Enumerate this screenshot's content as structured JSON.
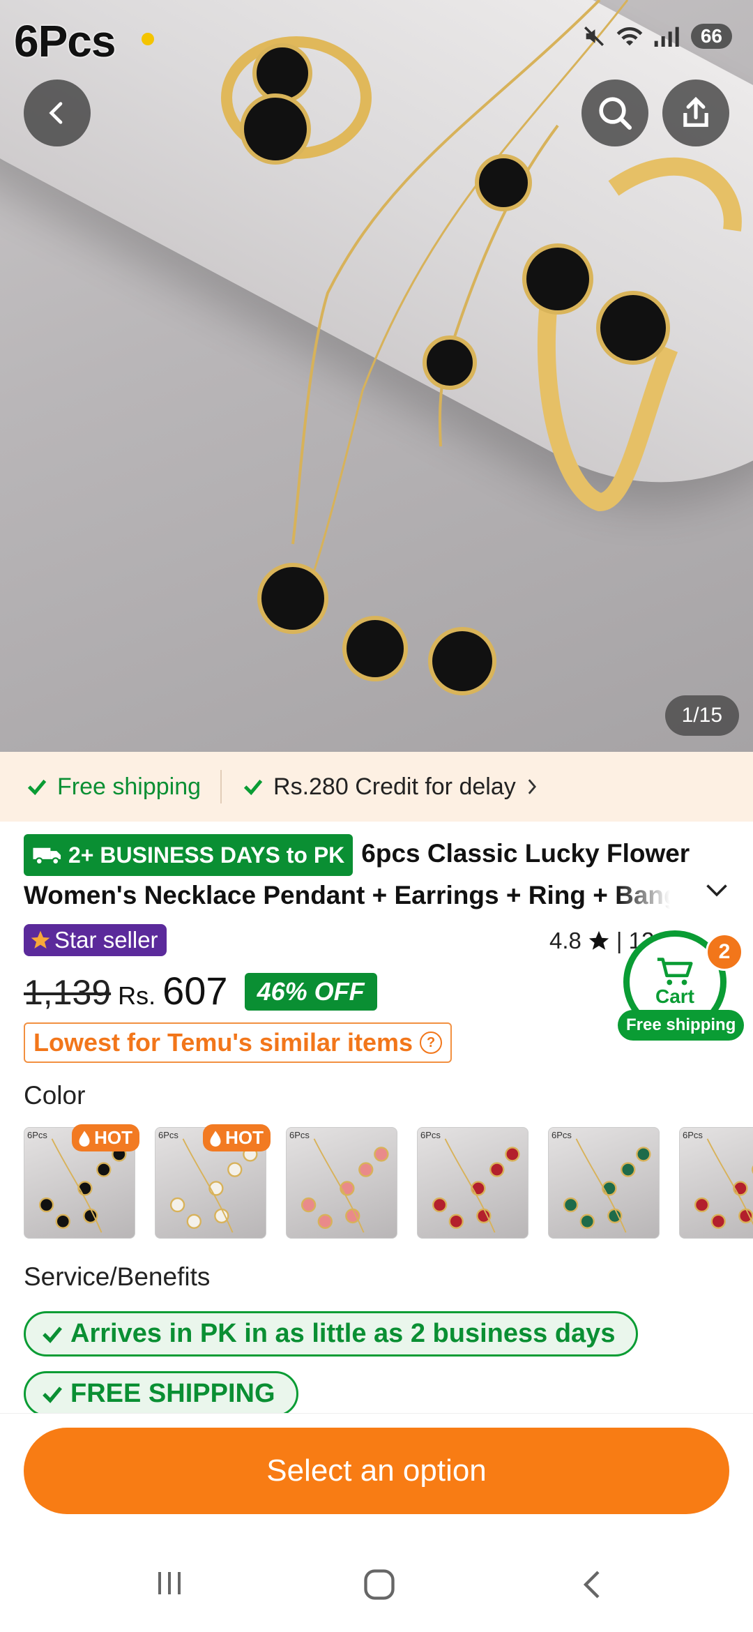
{
  "status_bar": {
    "overlay_label": "6Pcs",
    "battery": "66"
  },
  "gallery": {
    "counter": "1/15"
  },
  "shipping_bar": {
    "free_shipping": "Free shipping",
    "credit": "Rs.280 Credit for delay"
  },
  "product": {
    "delivery_badge": "2+ BUSINESS DAYS to PK",
    "title": "6pcs Classic Lucky Flower Women's Necklace Pendant + Earrings + Ring + Bang",
    "star_seller": "Star seller",
    "rating": "4.8",
    "rating_rest": "| 12",
    "old_price": "1,139",
    "currency": "Rs.",
    "price": "607",
    "discount": "46% OFF",
    "lowest": "Lowest for Temu's similar items"
  },
  "cart": {
    "label": "Cart",
    "count": "2",
    "free_shipping": "Free shipping"
  },
  "color": {
    "label": "Color",
    "options": [
      {
        "tag": "6Pcs",
        "badge": "HOT",
        "flower_color": "#111111"
      },
      {
        "tag": "6Pcs",
        "badge": "HOT",
        "flower_color": "#f4f1ea"
      },
      {
        "tag": "6Pcs",
        "badge": "",
        "flower_color": "#e98a8a"
      },
      {
        "tag": "6Pcs",
        "badge": "",
        "flower_color": "#b3202c"
      },
      {
        "tag": "6Pcs",
        "badge": "",
        "flower_color": "#1d6b4a"
      },
      {
        "tag": "6Pcs",
        "badge": "",
        "flower_color": "#b3202c"
      }
    ]
  },
  "services": {
    "label": "Service/Benefits",
    "items": [
      "Arrives in PK in as little as 2 business days",
      "FREE SHIPPING"
    ]
  },
  "cta": {
    "label": "Select an option"
  },
  "colors": {
    "accent": "#f87c14",
    "green": "#0a9c34",
    "purple": "#5b2a9b"
  }
}
